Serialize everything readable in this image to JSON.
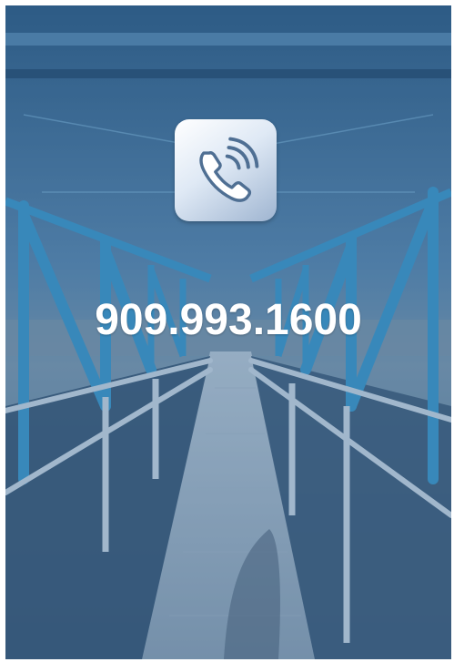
{
  "contact": {
    "phone_number": "909.993.1600",
    "icon": "phone-call-icon"
  },
  "colors": {
    "overlay_blue": "#3b6a92",
    "truss_blue": "#3f8fc0",
    "text": "#ffffff"
  }
}
